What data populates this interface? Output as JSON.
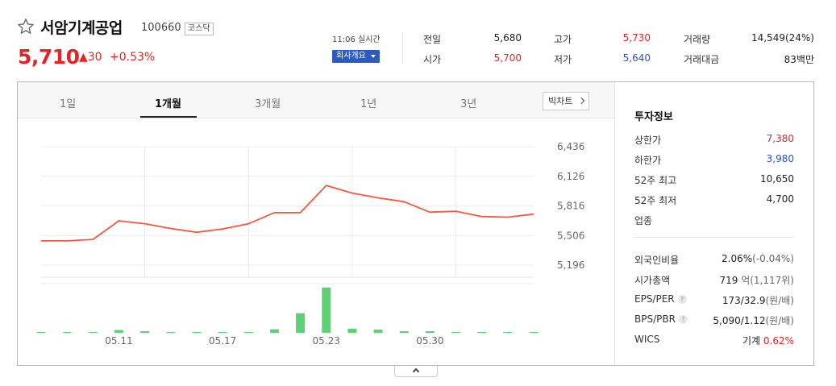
{
  "stock": {
    "name": "서암기계공업",
    "code": "100660",
    "market": "코스닥",
    "price": "5,710",
    "change": "▲30",
    "change_pct": "+0.53%",
    "realtime": "11:06 실시간",
    "company_button": "회사개요"
  },
  "quotes": [
    {
      "label": "전일",
      "value": "5,680",
      "color": "dark"
    },
    {
      "label": "고가",
      "value": "5,730",
      "color": "red"
    },
    {
      "label": "거래량",
      "value": "14,549(24%)",
      "color": "dark"
    },
    {
      "label": "시가",
      "value": "5,700",
      "color": "red"
    },
    {
      "label": "저가",
      "value": "5,640",
      "color": "blue"
    },
    {
      "label": "거래대금",
      "value": "83백만",
      "color": "dark"
    }
  ],
  "tabs": [
    "1일",
    "1개월",
    "3개월",
    "1년",
    "3년"
  ],
  "active_tab": "1개월",
  "big_chart_label": "빅차트",
  "chart_data": {
    "type": "line",
    "title": "",
    "line_color": "#f05a3c",
    "volume_color": "#5dd176",
    "ylim": [
      5196,
      6436
    ],
    "y_ticks": [
      "6,436",
      "6,126",
      "5,816",
      "5,506",
      "5,196"
    ],
    "x_tick_labels": [
      "05.11",
      "05.17",
      "05.23",
      "05.30"
    ],
    "price_series": [
      5450,
      5450,
      5465,
      5660,
      5630,
      5580,
      5540,
      5575,
      5630,
      5745,
      5745,
      6030,
      5950,
      5900,
      5860,
      5750,
      5760,
      5705,
      5698,
      5730
    ],
    "volume_series": [
      0.012,
      0.012,
      0.012,
      0.06,
      0.035,
      0.012,
      0.012,
      0.012,
      0.012,
      0.075,
      0.42,
      0.97,
      0.09,
      0.07,
      0.035,
      0.035,
      0.012,
      0.012,
      0.012,
      0.012
    ]
  },
  "invest": {
    "title": "투자정보",
    "rows": [
      {
        "label": "상한가",
        "value": "7,380",
        "color": "red"
      },
      {
        "label": "하한가",
        "value": "3,980",
        "color": "blue"
      },
      {
        "label": "52주 최고",
        "value": "10,650",
        "color": "dark"
      },
      {
        "label": "52주 최저",
        "value": "4,700",
        "color": "dark"
      },
      {
        "label": "업종",
        "value": "",
        "color": "dark"
      }
    ],
    "rows2": [
      {
        "label": "외국인비율",
        "value": "2.06%",
        "sub": "(-0.04%)"
      },
      {
        "label": "시가총액",
        "value": "719",
        "sub": "억(1,117위)"
      },
      {
        "label": "EPS/PER",
        "value": "173/32.9",
        "sub": "(원/배)",
        "help": true
      },
      {
        "label": "BPS/PBR",
        "value": "5,090/1.12",
        "sub": "(원/배)",
        "help": true
      }
    ],
    "wics_label": "WICS",
    "wics_value": "기계",
    "wics_pct": "0.62%"
  }
}
